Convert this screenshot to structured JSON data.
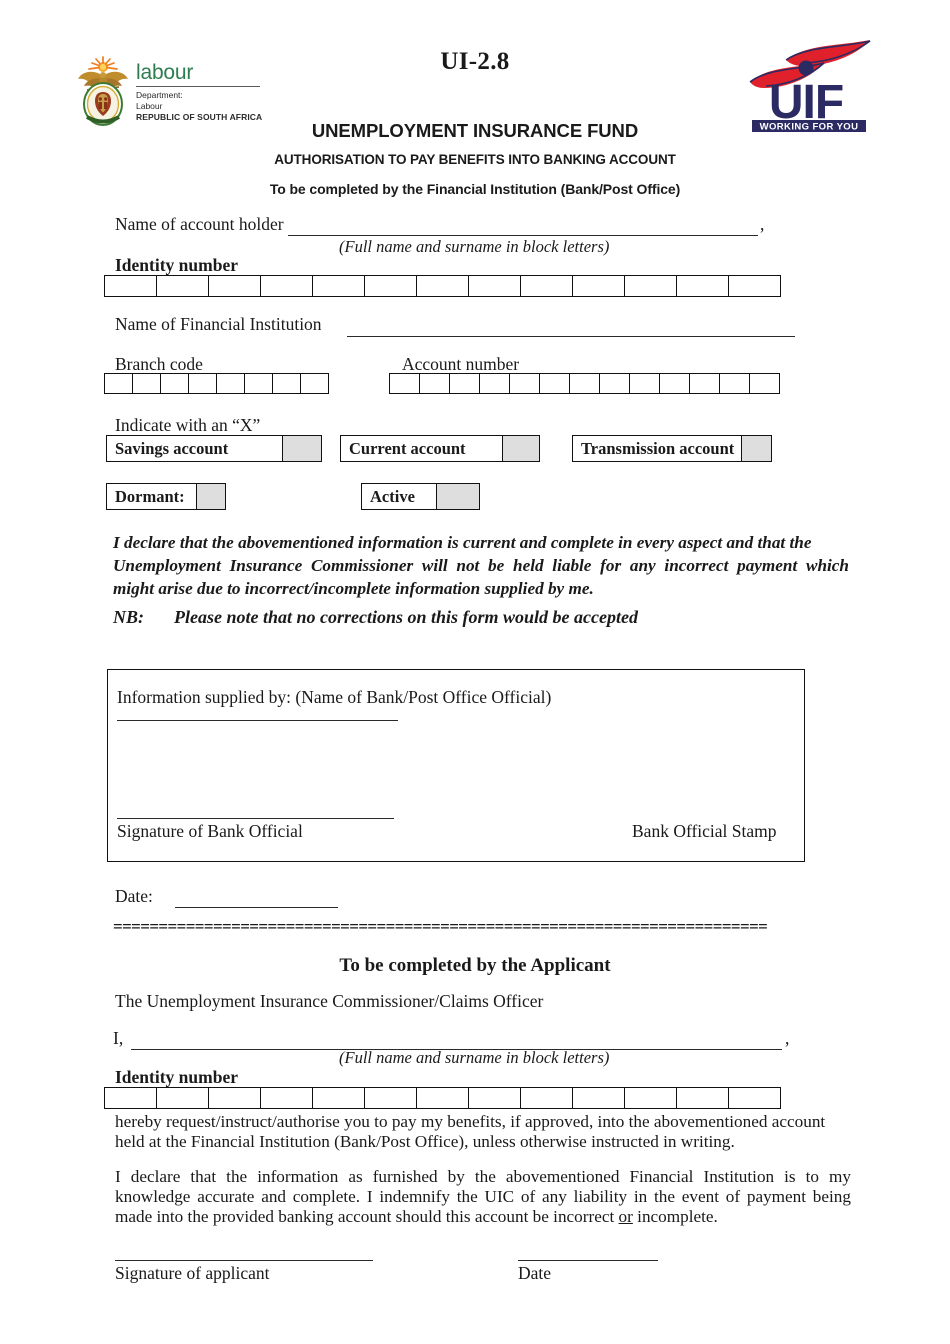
{
  "document": {
    "form_code": "UI-2.8",
    "organisation": "UNEMPLOYMENT INSURANCE FUND",
    "purpose": "AUTHORISATION TO PAY BENEFITS INTO BANKING ACCOUNT",
    "section_a_instruction": "To be completed by the Financial Institution (Bank/Post Office)"
  },
  "logos": {
    "coat_of_arms": {
      "name": "south-african-coat-of-arms",
      "colors": {
        "sunburst": "#f59a1e",
        "bird": "#b8862b",
        "shield": "#8a6a1f",
        "ring": "#d4af37",
        "green": "#3d7a33"
      }
    },
    "labour": {
      "wordmark": "labour",
      "department_line1": "Department:",
      "department_line2": "Labour",
      "department_line3": "REPUBLIC OF SOUTH AFRICA",
      "wordmark_color": "#2e7d4f"
    },
    "uif": {
      "acronym": "UIF",
      "tagline": "WORKING FOR YOU",
      "navy": "#2b2a63",
      "red": "#e0212b"
    }
  },
  "section_bank": {
    "account_holder_label": "Name of account holder",
    "account_holder_value": "",
    "account_holder_trailing": ",",
    "block_letters_hint": "(Full name and surname in block letters)",
    "identity_number_label": "Identity number",
    "identity_number_cells": 13,
    "identity_number_value": "",
    "financial_institution_label": "Name of Financial Institution",
    "financial_institution_value": "",
    "branch_code_label": "Branch code",
    "branch_code_cells": 8,
    "branch_code_value": "",
    "account_number_label": "Account number",
    "account_number_cells": 13,
    "account_number_value": "",
    "indicate_instruction": "Indicate with an “X”",
    "account_types": [
      {
        "label": "Savings account",
        "checked": ""
      },
      {
        "label": "Current account",
        "checked": ""
      },
      {
        "label": "Transmission account",
        "checked": ""
      }
    ],
    "account_status": [
      {
        "label": "Dormant:",
        "checked": ""
      },
      {
        "label": "Active",
        "checked": ""
      }
    ],
    "declaration_line1": "I declare that the abovementioned information is current and complete in every aspect and that the",
    "declaration_line2": "Unemployment Insurance Commissioner will not be held liable for any incorrect payment which",
    "declaration_line3": "might arise due to incorrect/incomplete information supplied by me.",
    "nb_label": "NB:",
    "nb_text": "Please note that no corrections on this form would be accepted",
    "official_box": {
      "supplied_by_label": "Information supplied by: (Name of Bank/Post Office Official)",
      "supplied_by_value": "",
      "signature_label": "Signature of Bank Official",
      "signature_value": "",
      "stamp_label": "Bank Official Stamp"
    },
    "date_label": "Date:",
    "date_value": ""
  },
  "divider": {
    "characters": "========================================================================"
  },
  "section_applicant": {
    "heading": "To be completed by the Applicant",
    "addressee": "The Unemployment Insurance Commissioner/Claims Officer",
    "i_label": "I,",
    "i_value": "",
    "i_trailing": ",",
    "block_letters_hint": "(Full name and surname in block letters)",
    "identity_number_label": "Identity number",
    "identity_number_cells": 13,
    "identity_number_value": "",
    "request_line1": "hereby request/instruct/authorise you to pay my benefits, if approved, into the abovementioned account",
    "request_line2": "held at the Financial Institution (Bank/Post Office), unless otherwise instructed in writing.",
    "indemnity_line1": "I declare that the information as furnished by the abovementioned Financial Institution is to my",
    "indemnity_line2_a": "knowledge accurate and complete.  I indemnify the UIC of any liability in the event of payment being",
    "indemnity_line3_a": "made into the provided banking account should this account be incorrect ",
    "indemnity_line3_underlined": "or",
    "indemnity_line3_b": " incomplete.",
    "signature_label": "Signature of applicant",
    "signature_value": "",
    "date_label": "Date",
    "date_value": ""
  }
}
